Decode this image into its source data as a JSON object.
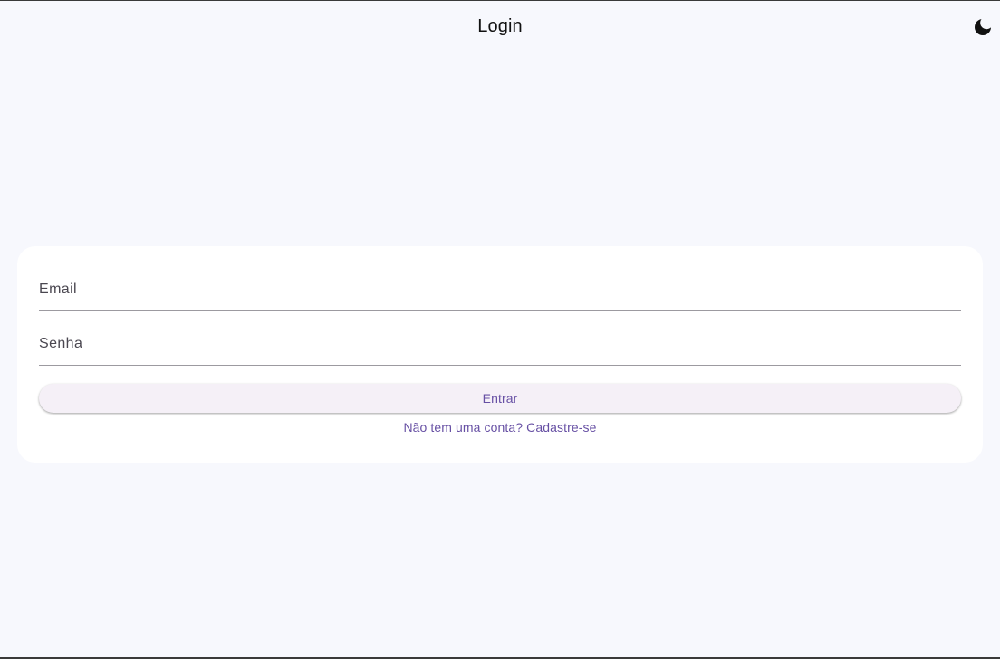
{
  "appbar": {
    "title": "Login",
    "theme_toggle_icon": "moon-icon"
  },
  "form": {
    "email_label": "Email",
    "password_label": "Senha",
    "submit_label": "Entrar",
    "signup_link": "Não tem uma conta? Cadastre-se"
  },
  "colors": {
    "background": "#f7f8fd",
    "card": "#ffffff",
    "accent": "#6750a4",
    "button_bg": "#f5f0f7"
  }
}
